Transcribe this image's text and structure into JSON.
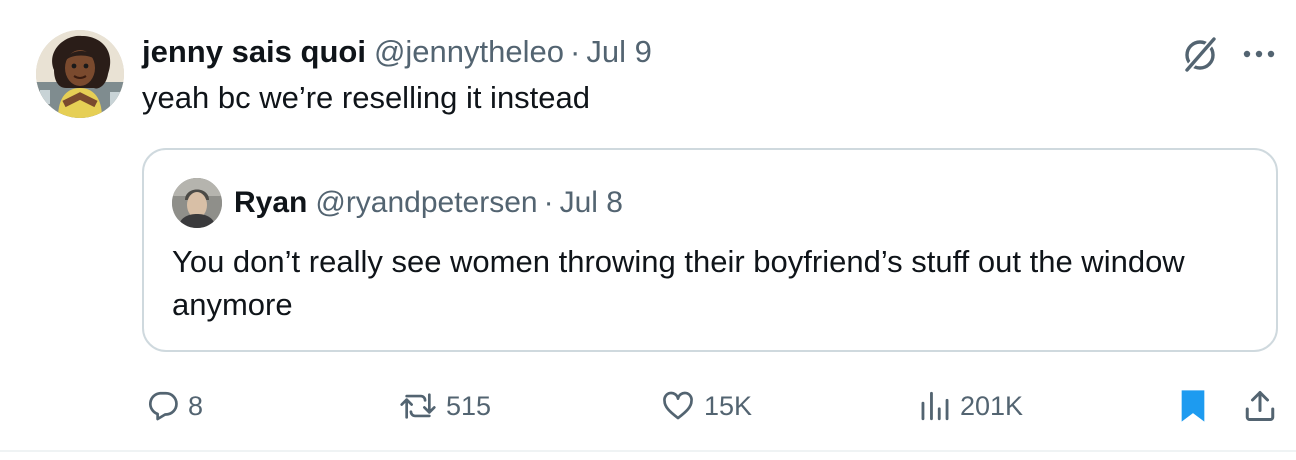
{
  "tweet": {
    "author_name": "jenny sais quoi",
    "author_handle": "@jennytheleo",
    "separator": "·",
    "date": "Jul 9",
    "text": "yeah bc we’re reselling it instead",
    "avatar_icon": "cartoon-avatar",
    "grok_icon": "grok-slash-circle-icon",
    "more_icon": "more-dots-icon"
  },
  "quote": {
    "author_name": "Ryan",
    "author_handle": "@ryandpetersen",
    "separator": "·",
    "date": "Jul 8",
    "text": "You don’t really see women throwing their boyfriend’s stuff out the window anymore",
    "avatar_icon": "photo-avatar"
  },
  "actions": {
    "replies": "8",
    "reposts": "515",
    "likes": "15K",
    "views": "201K",
    "bookmark_icon": "bookmark-filled-icon",
    "share_icon": "share-icon"
  },
  "colors": {
    "text_primary": "#0f1419",
    "text_secondary": "#536471",
    "border": "#cfd9de",
    "accent_blue": "#1d9bf0"
  }
}
